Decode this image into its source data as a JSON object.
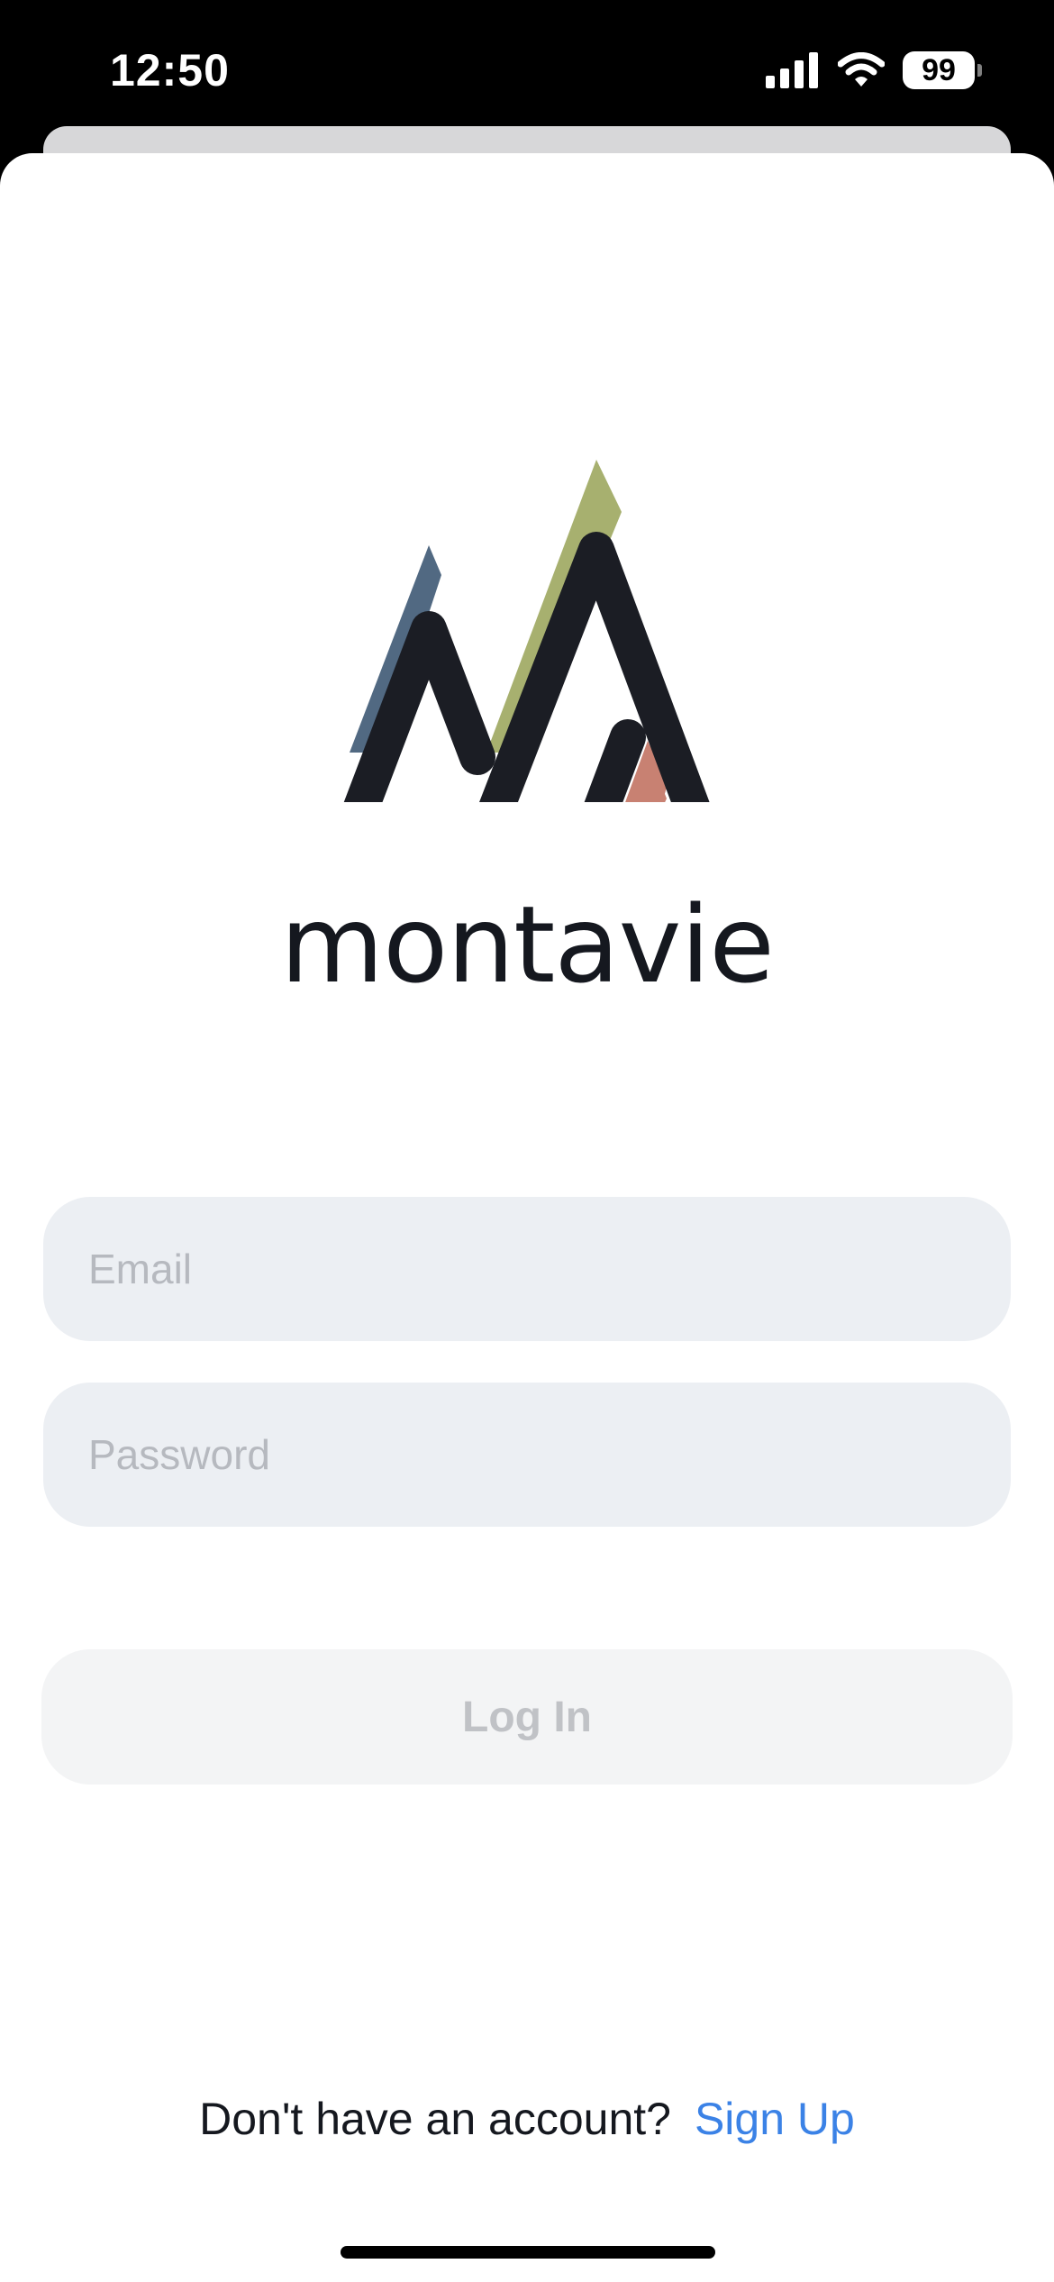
{
  "status_bar": {
    "time": "12:50",
    "battery_level": "99",
    "icons": [
      "signal-icon",
      "wifi-icon",
      "battery-icon"
    ]
  },
  "brand": {
    "name": "montavie",
    "colors": {
      "outline": "#1b1d24",
      "left_peak": "#516982",
      "middle_peak": "#a7b06f",
      "right_peak": "#c88172"
    }
  },
  "form": {
    "email_placeholder": "Email",
    "email_value": "",
    "password_placeholder": "Password",
    "password_value": "",
    "login_label": "Log In"
  },
  "footer": {
    "prompt": "Don't have an account?",
    "signup_label": "Sign Up",
    "link_color": "#3b82e6"
  }
}
